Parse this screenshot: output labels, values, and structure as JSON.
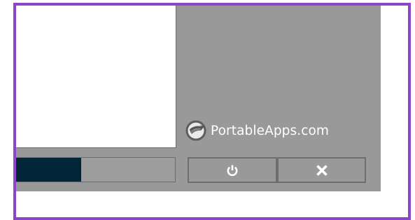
{
  "brand": {
    "name": "PortableApps.com",
    "logo_icon": "portableapps-logo-icon"
  },
  "drive": {
    "usage_fraction": 0.41
  },
  "buttons": {
    "power_icon": "power-icon",
    "close_icon": "close-icon"
  },
  "colors": {
    "panel": "#999999",
    "drive_fill": "#012638",
    "frame_border": "#8e44c8"
  }
}
